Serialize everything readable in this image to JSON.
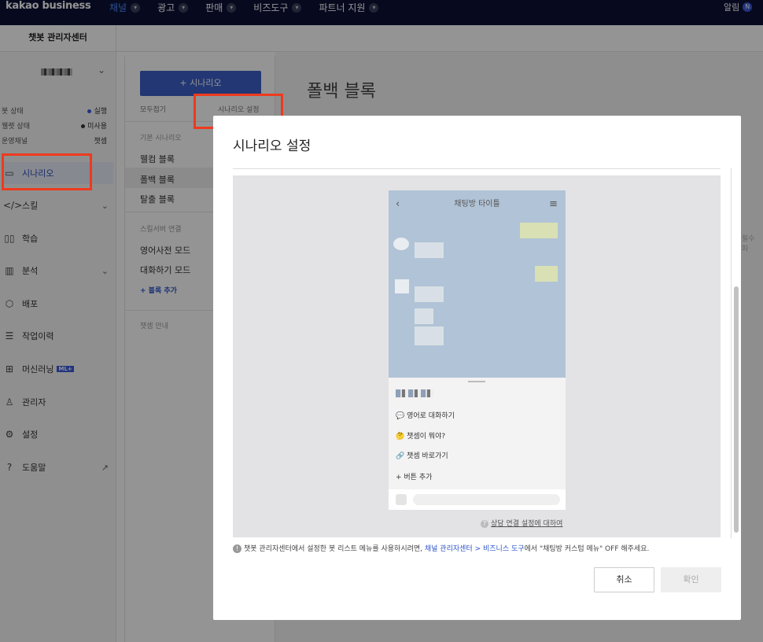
{
  "topbar": {
    "logo": "kakao business",
    "nav": [
      "채널",
      "광고",
      "판매",
      "비즈도구",
      "파트너 지원"
    ],
    "active_index": 0,
    "alarm": "알림",
    "alarm_badge": "N"
  },
  "subbar": {
    "title": "챗봇 관리자센터"
  },
  "sidebar": {
    "status": [
      {
        "label": "봇 상태",
        "value": "실행",
        "dot_color": "#3b5bdb"
      },
      {
        "label": "웰렛 상태",
        "value": "미사용",
        "dot_color": "#333333"
      },
      {
        "label": "운영채널",
        "value": "챗셈"
      }
    ],
    "menu": [
      {
        "label": "시나리오",
        "icon": "scenario-icon"
      },
      {
        "label": "스킬",
        "icon": "code-icon"
      },
      {
        "label": "학습",
        "icon": "book-icon"
      },
      {
        "label": "분석",
        "icon": "chart-icon"
      },
      {
        "label": "배포",
        "icon": "deploy-icon"
      },
      {
        "label": "작업이력",
        "icon": "history-icon"
      },
      {
        "label": "머신러닝",
        "icon": "chip-icon",
        "badge": "ML+"
      },
      {
        "label": "관리자",
        "icon": "users-icon"
      },
      {
        "label": "설정",
        "icon": "gear-icon"
      },
      {
        "label": "도움말",
        "icon": "help-icon"
      }
    ]
  },
  "scenario_panel": {
    "add_button": "+ 시나리오",
    "collapse_all": "모두접기",
    "scenario_settings": "시나리오 설정",
    "basic_section": "기본 시나리오",
    "basic_items": [
      "웰컴 블록",
      "폴백 블록",
      "탈출 블록"
    ],
    "skill_section": "스킬서버 연결",
    "skill_items": [
      "영어사전 모드",
      "대화하기 모드"
    ],
    "add_block": "+ 블록 추가",
    "guide_section": "챗셈 안내"
  },
  "main": {
    "title": "폴백 블록",
    "side_text": "필수 파"
  },
  "modal": {
    "title": "시나리오 설정",
    "chat_title": "채팅방 타이틀",
    "quick_items": [
      {
        "icon": "💬",
        "label": "영어로 대화하기"
      },
      {
        "icon": "🤔",
        "label": "챗셈이 뭐야?"
      },
      {
        "icon": "🔗",
        "label": "챗셈 바로가기"
      }
    ],
    "add_button": "+ 버튼 추가",
    "help_link": "상담 연결 설정에 대하여",
    "notice_prefix": "챗봇 관리자센터에서 설정한 봇 리스트 메뉴를 사용하시려면, ",
    "notice_link": "채널 관리자센터 > 비즈니스 도구",
    "notice_suffix": "에서 \"채팅방 커스텀 메뉴\" OFF 해주세요.",
    "cancel": "취소",
    "confirm": "확인"
  }
}
